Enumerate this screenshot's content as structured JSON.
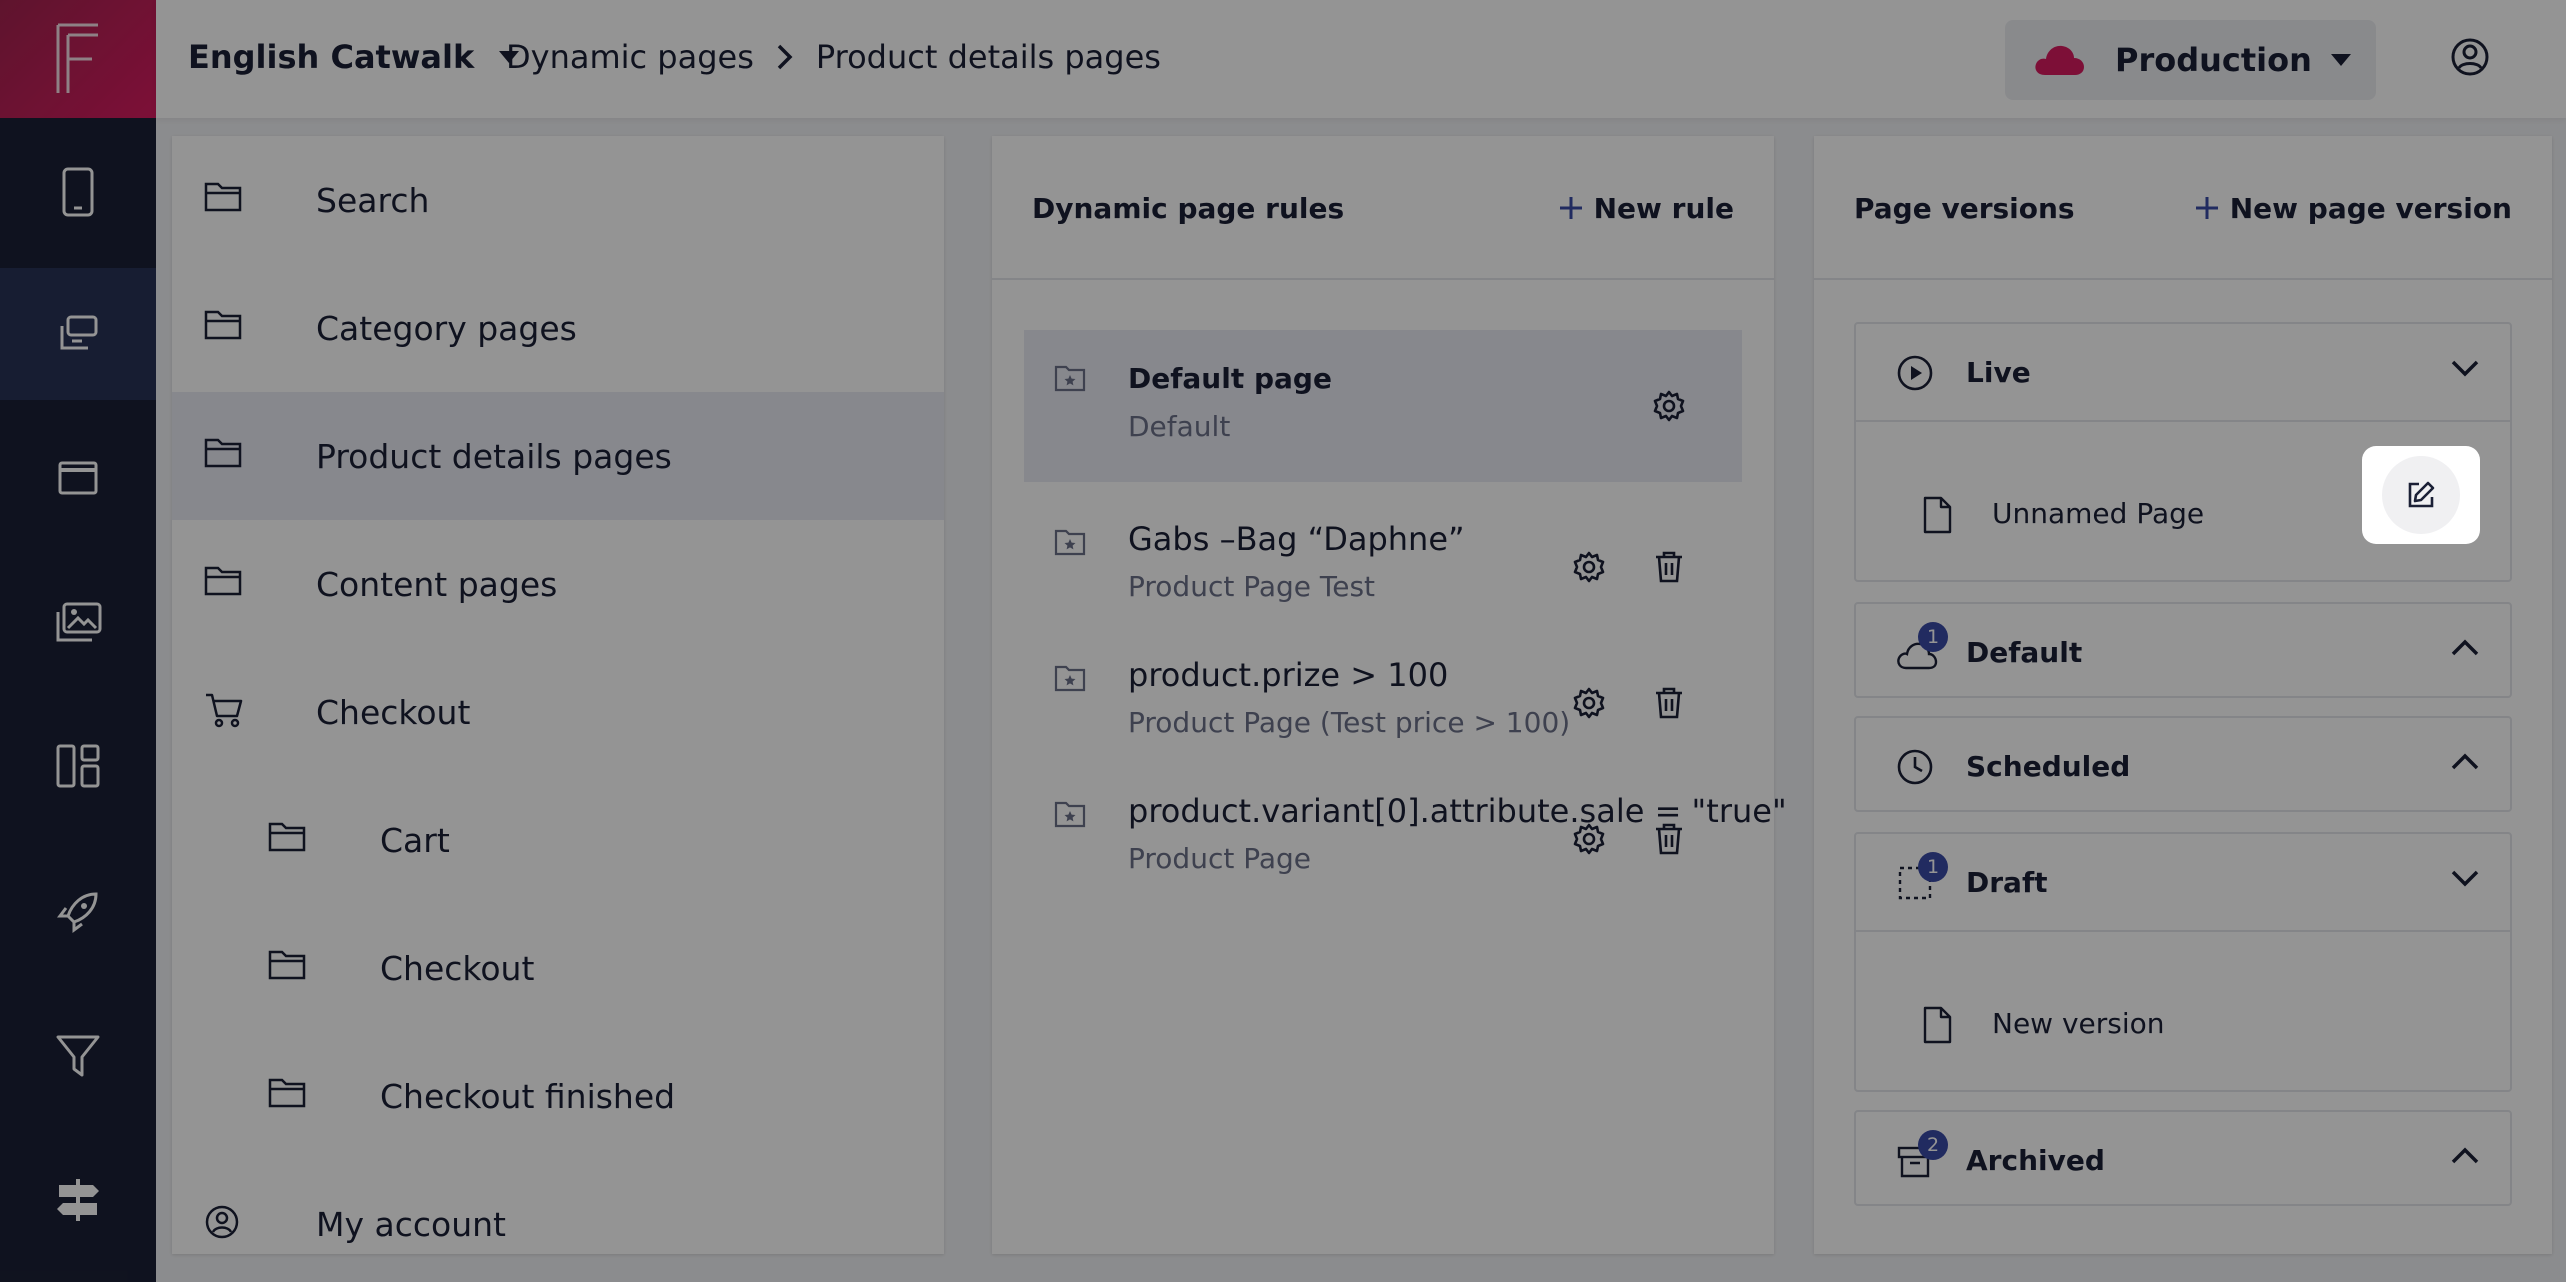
{
  "header": {
    "store": "English Catwalk",
    "breadcrumb": [
      "Dynamic pages",
      "Product details pages"
    ],
    "environment": "Production",
    "accent": "#d81b60"
  },
  "rail": {
    "items": [
      "mobile-icon",
      "pages-icon",
      "window-icon",
      "media-icon",
      "layout-icon",
      "rocket-icon",
      "filter-icon",
      "signpost-icon"
    ],
    "active": 1
  },
  "page_tree": {
    "items": [
      {
        "label": "Search",
        "icon": "folder-icon",
        "level": 0
      },
      {
        "label": "Category pages",
        "icon": "folder-icon",
        "level": 0
      },
      {
        "label": "Product details pages",
        "icon": "folder-icon",
        "level": 0,
        "selected": true
      },
      {
        "label": "Content pages",
        "icon": "folder-icon",
        "level": 0
      },
      {
        "label": "Checkout",
        "icon": "cart-icon",
        "level": 0
      },
      {
        "label": "Cart",
        "icon": "folder-icon",
        "level": 1
      },
      {
        "label": "Checkout",
        "icon": "folder-icon",
        "level": 1
      },
      {
        "label": "Checkout finished",
        "icon": "folder-icon",
        "level": 1
      },
      {
        "label": "My account",
        "icon": "user-circle-icon",
        "level": 0
      }
    ]
  },
  "rules_panel": {
    "title": "Dynamic page rules",
    "action": "New rule",
    "rules": [
      {
        "title": "Default page",
        "subtitle": "Default"
      },
      {
        "title": "Gabs –Bag “Daphne”",
        "subtitle": "Product Page Test"
      },
      {
        "title": "product.prize > 100",
        "subtitle": "Product Page (Test price > 100)"
      },
      {
        "title": "product.variant[0].attribute.sale = \"true\"",
        "subtitle": "Product Page"
      }
    ]
  },
  "versions_panel": {
    "title": "Page versions",
    "action": "New page version",
    "groups": [
      {
        "label": "Live",
        "expanded": true,
        "items": [
          "Unnamed Page"
        ]
      },
      {
        "label": "Default",
        "badge": "1",
        "expanded": false
      },
      {
        "label": "Scheduled",
        "expanded": false
      },
      {
        "label": "Draft",
        "badge": "1",
        "expanded": true,
        "items": [
          "New version"
        ]
      },
      {
        "label": "Archived",
        "badge": "2",
        "expanded": false
      }
    ]
  }
}
